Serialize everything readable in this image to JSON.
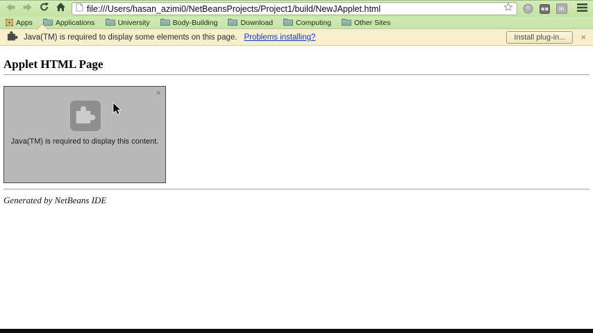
{
  "browser": {
    "toolbar": {
      "url": "file:///Users/hasan_azimi0/NetBeansProjects/Project1/build/NewJApplet.html",
      "extension_badge": "in"
    },
    "bookmarks_bar": {
      "apps_label": "Apps",
      "folders": [
        "Applications",
        "University",
        "Body-Building",
        "Download",
        "Computing",
        "Other Sites"
      ]
    }
  },
  "infobar": {
    "message": "Java(TM) is required to display some elements on this page.",
    "link_label": "Problems installing?",
    "install_button_label": "Install plug-in...",
    "close_label": "×"
  },
  "page": {
    "heading": "Applet HTML Page",
    "applet_placeholder": {
      "message": "Java(TM) is required to display this content.",
      "close_label": "×"
    },
    "footer_note": "Generated by NetBeans IDE"
  },
  "colors": {
    "toolbar_green": "#c9e6aa",
    "infobar_cream": "#f8f0cd",
    "link_blue": "#1a35c4",
    "applet_gray": "#b9b9b9",
    "applet_tile_gray": "#8e8e8e"
  },
  "icons": [
    "back-arrow-icon",
    "forward-arrow-icon",
    "reload-icon",
    "home-icon",
    "page-icon",
    "bookmark-star-icon",
    "extension-circle-icon",
    "extension-boxes-icon",
    "extension-in-icon",
    "menu-icon",
    "apps-grid-icon",
    "folder-icon",
    "puzzle-icon",
    "close-icon",
    "arrow-cursor"
  ]
}
